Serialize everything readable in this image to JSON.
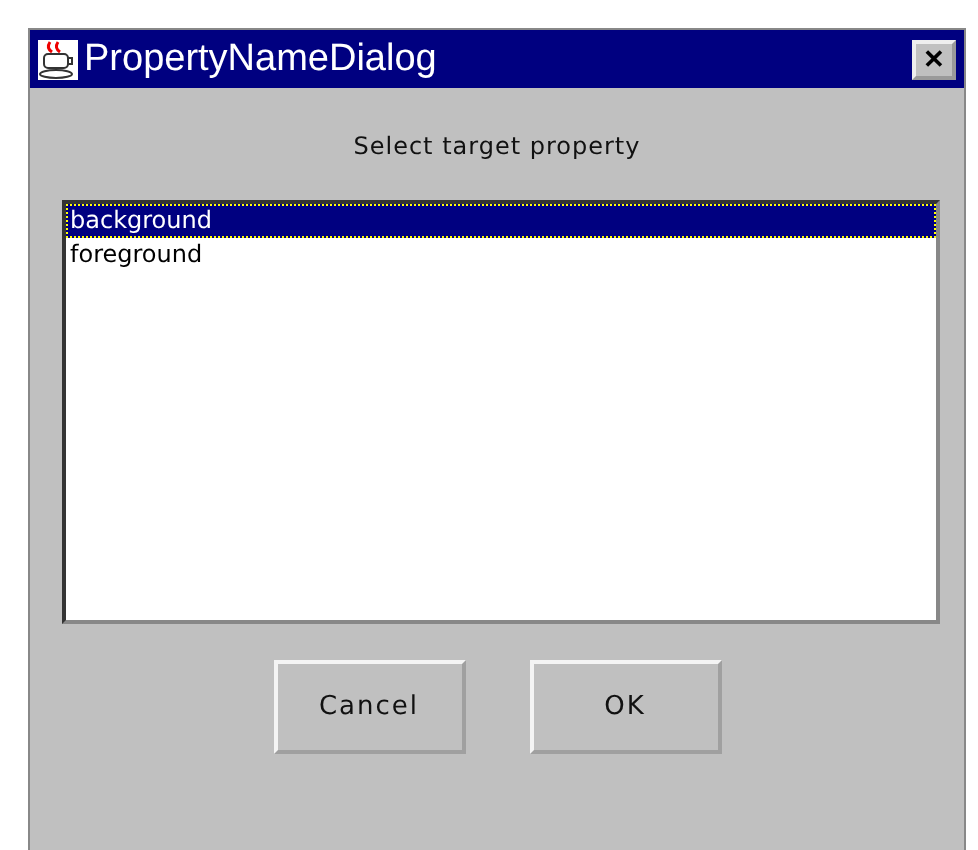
{
  "window": {
    "title": "PropertyNameDialog",
    "close": "✕"
  },
  "prompt": "Select target property",
  "list": {
    "items": [
      {
        "label": "background",
        "selected": true
      },
      {
        "label": "foreground",
        "selected": false
      }
    ]
  },
  "buttons": [
    "Cancel",
    "OK"
  ]
}
